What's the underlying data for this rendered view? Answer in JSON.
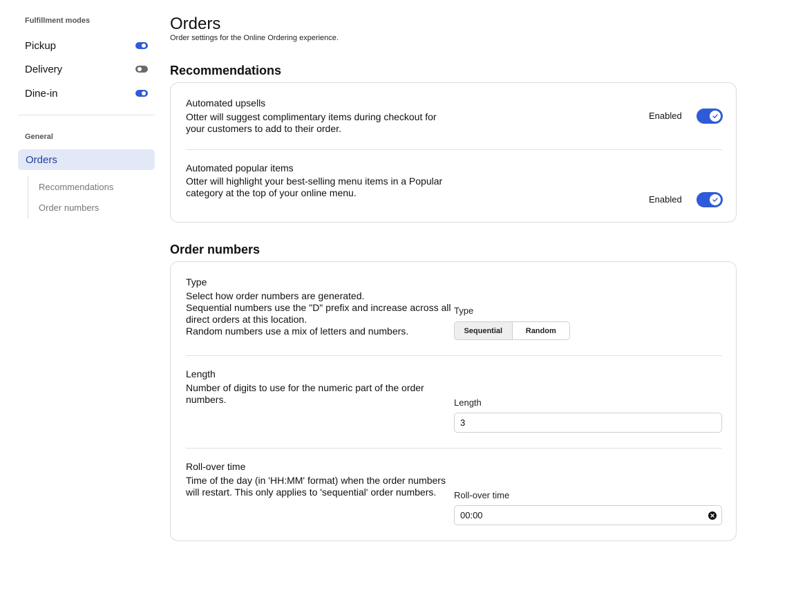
{
  "sidebar": {
    "fulfillment_heading": "Fulfillment modes",
    "modes": [
      {
        "label": "Pickup",
        "enabled": true
      },
      {
        "label": "Delivery",
        "enabled": false
      },
      {
        "label": "Dine-in",
        "enabled": true
      }
    ],
    "general_heading": "General",
    "active_item": "Orders",
    "sub_items": [
      "Recommendations",
      "Order numbers"
    ]
  },
  "page": {
    "title": "Orders",
    "subtitle": "Order settings for the Online Ordering experience."
  },
  "recommendations": {
    "section_title": "Recommendations",
    "items": [
      {
        "title": "Automated upsells",
        "description": "Otter will suggest complimentary items during checkout for your customers to add to their order.",
        "status_label": "Enabled",
        "enabled": true
      },
      {
        "title": "Automated popular items",
        "description": "Otter will highlight your best-selling menu items in a Popular category at the top of your online menu.",
        "status_label": "Enabled",
        "enabled": true
      }
    ]
  },
  "order_numbers": {
    "section_title": "Order numbers",
    "type": {
      "title": "Type",
      "description_lines": [
        "Select how order numbers are generated.",
        "Sequential numbers use the \"D\" prefix and increase across all direct orders at this location.",
        "Random numbers use a mix of letters and numbers."
      ],
      "field_label": "Type",
      "options": [
        "Sequential",
        "Random"
      ],
      "selected": "Sequential"
    },
    "length": {
      "title": "Length",
      "description": "Number of digits to use for the numeric part of the order numbers.",
      "field_label": "Length",
      "value": "3"
    },
    "rollover": {
      "title": "Roll-over time",
      "description": "Time of the day (in 'HH:MM' format) when the order numbers will restart. This only applies to 'sequential' order numbers.",
      "field_label": "Roll-over time",
      "value": "00:00"
    }
  },
  "colors": {
    "accent": "#2f5bd8",
    "nav_active_bg": "#e3e8f7",
    "nav_active_text": "#1f3f9a",
    "toggle_off": "#6b6b6b"
  }
}
